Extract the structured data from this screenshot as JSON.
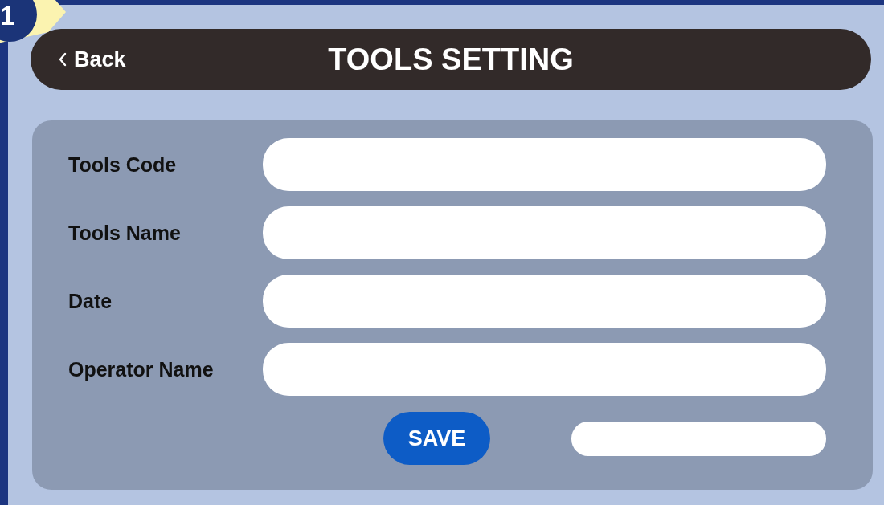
{
  "badge": {
    "label": "1"
  },
  "header": {
    "back": "Back",
    "title": "TOOLS SETTING"
  },
  "form": {
    "fields": [
      {
        "label": "Tools Code"
      },
      {
        "label": "Tools Name"
      },
      {
        "label": "Date"
      },
      {
        "label": "Operator Name"
      }
    ]
  },
  "save_button": "SAVE"
}
